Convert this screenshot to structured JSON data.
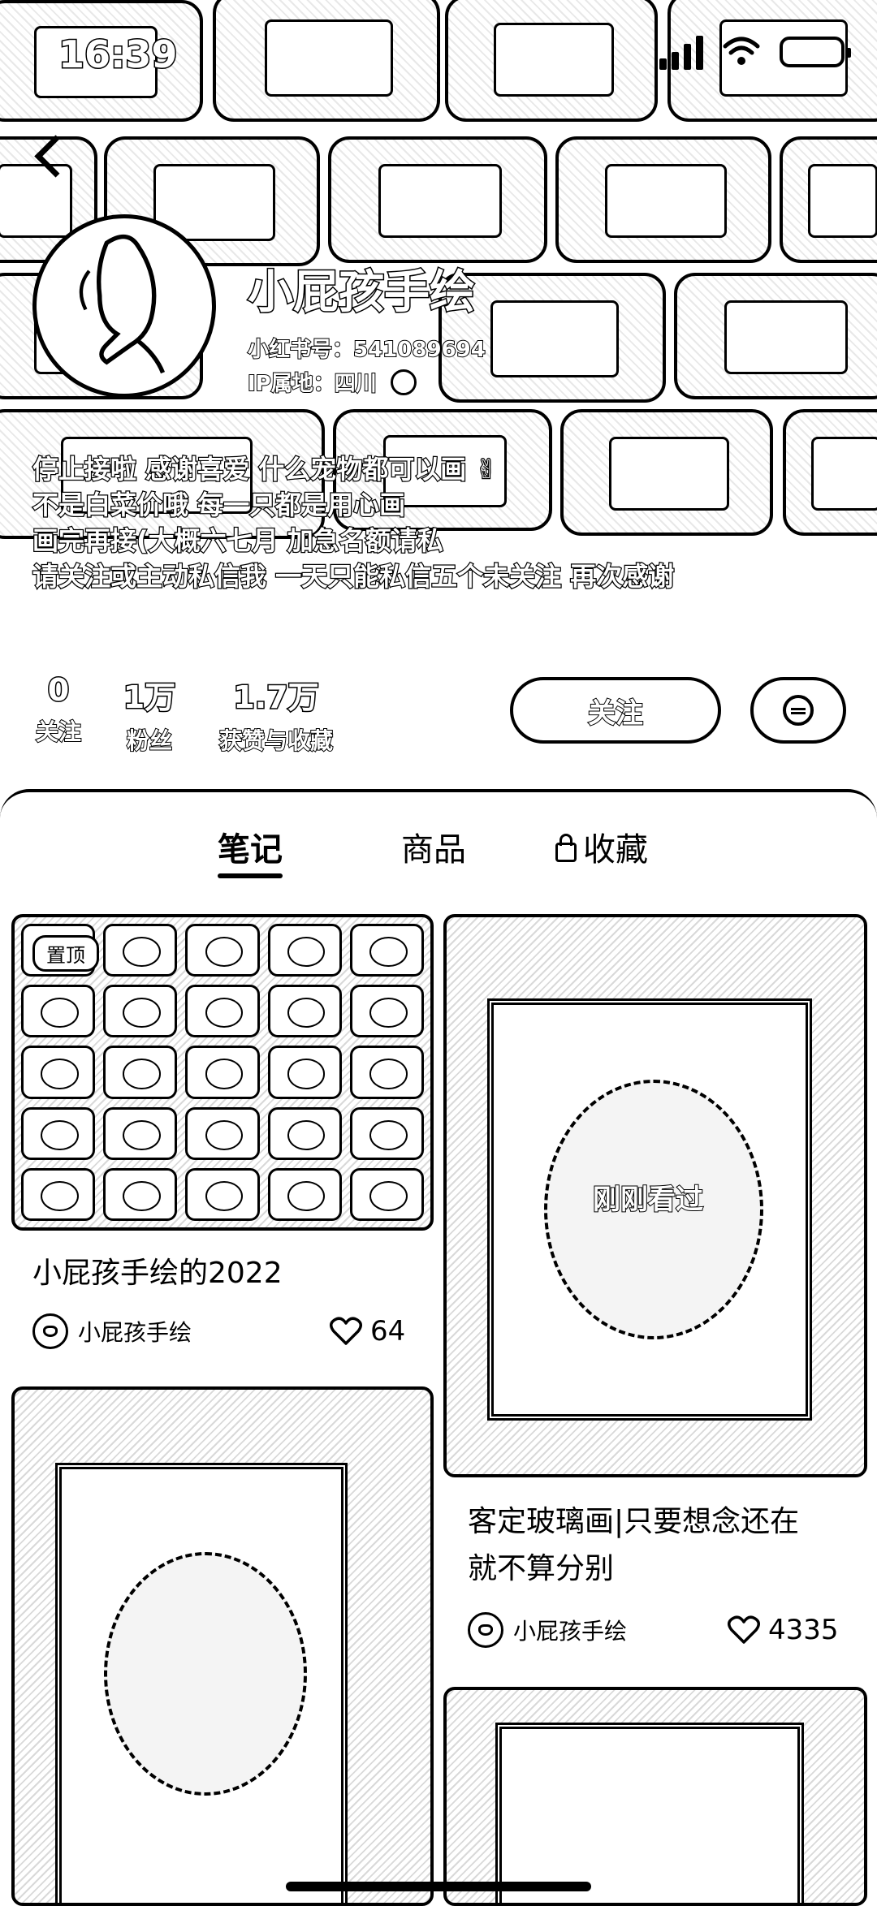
{
  "status_bar": {
    "time": "16:39"
  },
  "profile": {
    "nickname": "小屁孩手绘",
    "red_id": "小红书号：541089694",
    "ip_location": "IP属地：四川",
    "bio_lines": [
      "停止接啦 感谢喜爱 什么宠物都可以画 ✌",
      "不是白菜价哦 每一只都是用心画",
      "画完再接(大概六七月 加急名额请私",
      "请关注或主动私信我 一天只能私信五个未关注 再次感谢"
    ]
  },
  "stats": [
    {
      "value": "0",
      "label": "关注"
    },
    {
      "value": "1万",
      "label": "粉丝"
    },
    {
      "value": "1.7万",
      "label": "获赞与收藏"
    }
  ],
  "actions": {
    "follow_label": "关注"
  },
  "tabs": [
    {
      "label": "笔记",
      "active": true
    },
    {
      "label": "商品",
      "active": false
    },
    {
      "label": "收藏",
      "active": false,
      "locked": true
    }
  ],
  "notes": [
    {
      "badge": "置顶",
      "title": "小屁孩手绘的2022",
      "author": "小屁孩手绘",
      "likes": "64"
    },
    {
      "badge": "刚刚看过",
      "title_lines": [
        "客定玻璃画|只要想念还在",
        "就不算分别"
      ],
      "author": "小屁孩手绘",
      "likes": "4335"
    }
  ]
}
